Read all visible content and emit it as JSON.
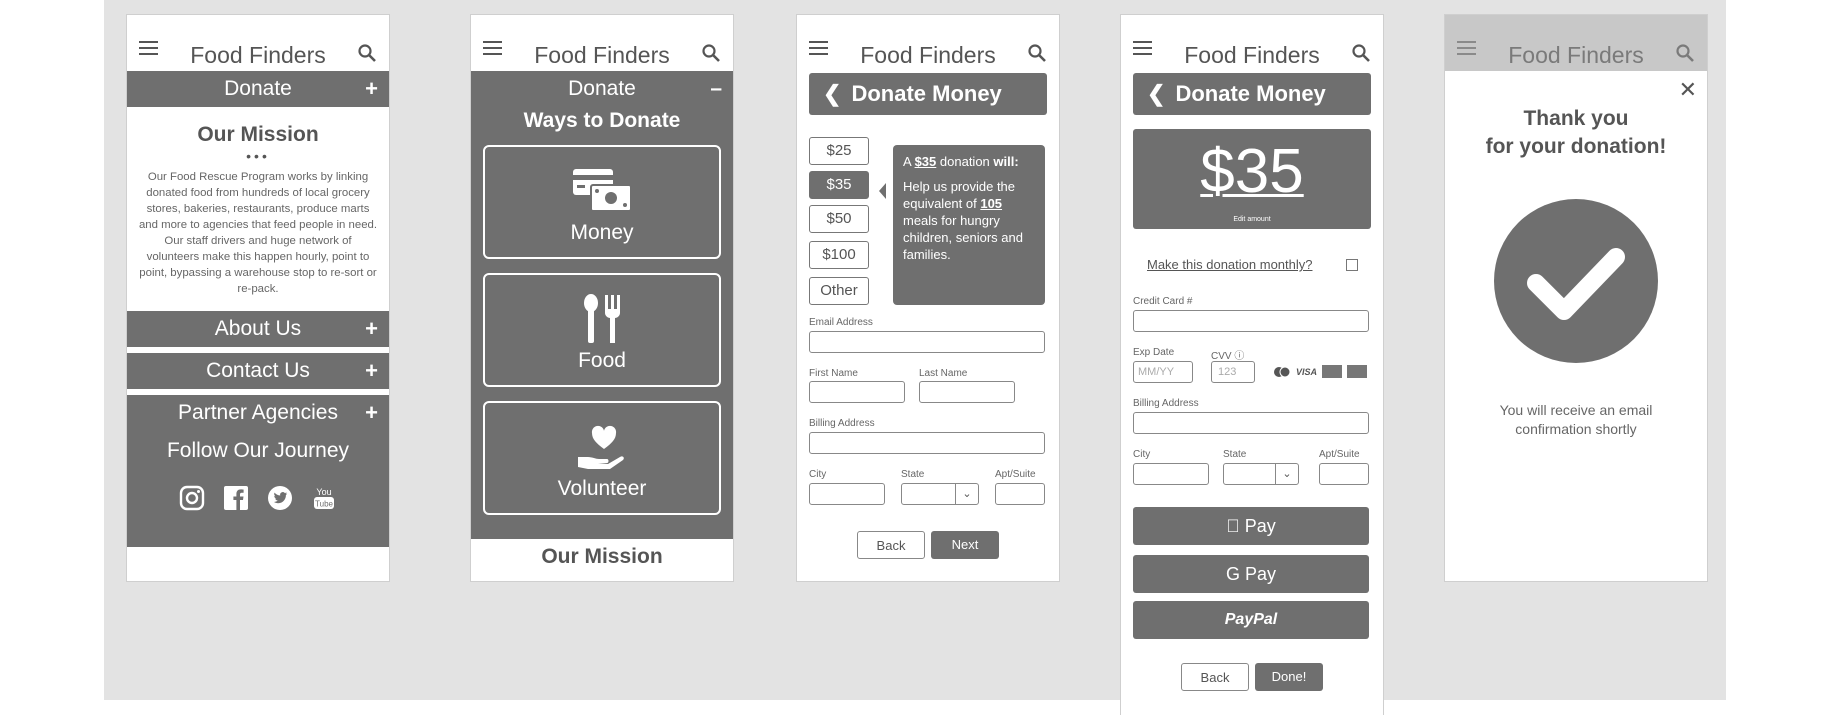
{
  "app_title": "Food Finders",
  "phone1": {
    "donate_label": "Donate",
    "donate_sign": "+",
    "mission_title": "Our Mission",
    "mission_dots": "•••",
    "mission_text": "Our Food Rescue Program works by linking donated food from hundreds of local grocery stores, bakeries, restaurants, produce marts and more to agencies that feed people in need. Our staff drivers and huge network of volunteers make this happen hourly, point to point, bypassing a warehouse stop to re-sort or re-pack.",
    "sections": [
      {
        "label": "About Us",
        "sign": "+"
      },
      {
        "label": "Contact Us",
        "sign": "+"
      },
      {
        "label": "Partner Agencies",
        "sign": "+"
      }
    ],
    "follow_title": "Follow Our Journey",
    "social_icons": [
      "instagram-icon",
      "facebook-icon",
      "twitter-icon",
      "youtube-icon"
    ]
  },
  "phone2": {
    "donate_label": "Donate",
    "donate_sign": "–",
    "ways_title": "Ways to Donate",
    "options": [
      {
        "label": "Money",
        "icon": "money-icon"
      },
      {
        "label": "Food",
        "icon": "utensils-icon"
      },
      {
        "label": "Volunteer",
        "icon": "heart-hand-icon"
      }
    ],
    "mission_title": "Our Mission"
  },
  "phone3": {
    "back_title": "Donate Money",
    "amounts": [
      "$25",
      "$35",
      "$50",
      "$100",
      "Other"
    ],
    "selected_amount": "$35",
    "tip_a": "A ",
    "tip_amount": "$35",
    "tip_b": " donation ",
    "tip_will": "will:",
    "tip_c": "Help us provide the equivalent of ",
    "tip_meals": "105",
    "tip_d": " meals for hungry children, seniors and families.",
    "email_label": "Email Address",
    "first_label": "First Name",
    "last_label": "Last Name",
    "billing_label": "Billing Address",
    "city_label": "City",
    "state_label": "State",
    "apt_label": "Apt/Suite",
    "back_button": "Back",
    "next_button": "Next"
  },
  "phone4": {
    "back_title": "Donate Money",
    "amount": "$35",
    "edit_amount": "Edit amount",
    "monthly_label": "Make this donation monthly?",
    "card_label": "Credit Card #",
    "exp_label": "Exp Date",
    "cvv_label": "CVV",
    "exp_placeholder": "MM/YY",
    "cvv_placeholder": "123",
    "billing_label": "Billing Address",
    "city_label": "City",
    "state_label": "State",
    "apt_label": "Apt/Suite",
    "apple_pay": " Pay",
    "google_pay": "G Pay",
    "paypal": "PayPal",
    "back_button": "Back",
    "done_button": "Done!",
    "card_brands": [
      "mastercard-icon",
      "visa-icon",
      "amex-icon",
      "discover-icon"
    ]
  },
  "phone5": {
    "thanks_line1": "Thank you",
    "thanks_line2": "for your donation!",
    "confirmation": "You will receive an email confirmation shortly",
    "close": "✕"
  }
}
